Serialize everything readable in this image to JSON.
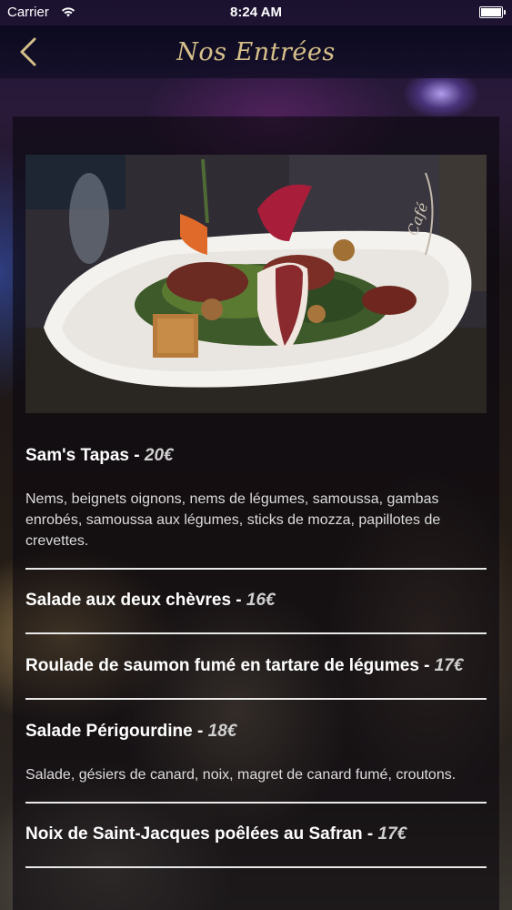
{
  "status_bar": {
    "carrier": "Carrier",
    "time": "8:24 AM"
  },
  "nav": {
    "title": "Nos Entrées"
  },
  "icons": {
    "wifi": "wifi-icon",
    "battery": "battery-icon",
    "back": "chevron-left-icon"
  },
  "colors": {
    "accent_gold": "#d6c08a",
    "text_white": "#ffffff",
    "divider": "#e9e9e9"
  },
  "menu": {
    "items": [
      {
        "name": "Sam's Tapas",
        "price": "20€",
        "description": "Nems, beignets oignons, nems de légumes, samoussa, gambas enrobés, samoussa aux légumes, sticks de mozza, papillotes de crevettes."
      },
      {
        "name": "Salade aux deux chèvres",
        "price": "16€"
      },
      {
        "name": "Roulade de saumon fumé en tartare de légumes",
        "price": "17€"
      },
      {
        "name": "Salade Périgourdine",
        "price": "18€",
        "description": "Salade, gésiers de canard, noix, magret de canard fumé, croutons."
      },
      {
        "name": "Noix de Saint-Jacques poêlées au Safran",
        "price": "17€"
      }
    ]
  }
}
